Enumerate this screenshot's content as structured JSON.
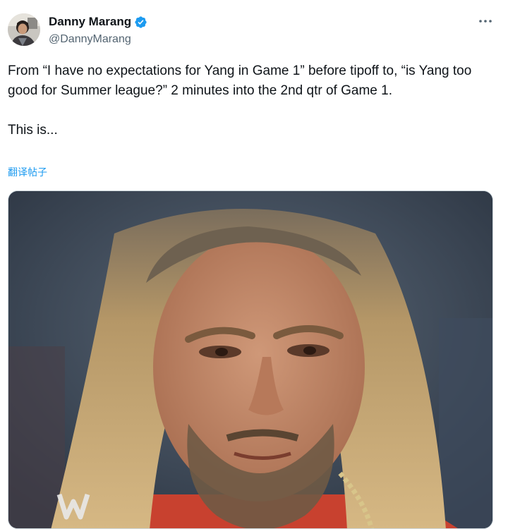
{
  "author": {
    "display_name": "Danny Marang",
    "handle": "@DannyMarang",
    "verified": true,
    "verified_color": "#1d9bf0"
  },
  "menu": {
    "more_icon": "more-horizontal-icon"
  },
  "tweet": {
    "text": "From “I have no expectations for Yang in Game 1” before tipoff to, “is Yang too good for Summer league?” 2 minutes into the 2nd qtr of Game 1.\n\nThis is...",
    "translate_label": "翻译帖子",
    "link_color": "#1d9bf0"
  },
  "media": {
    "type": "photo",
    "watermark": "W"
  }
}
